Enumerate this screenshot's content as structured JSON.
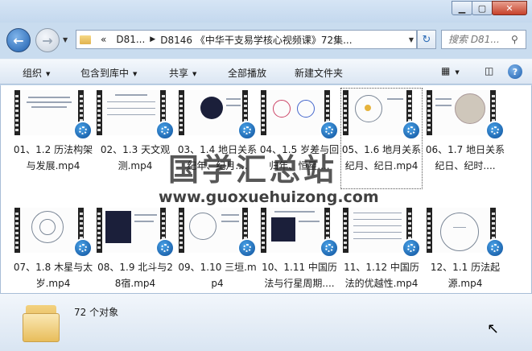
{
  "window": {
    "minimize": "▁",
    "maximize": "▢",
    "close": "✕"
  },
  "nav": {
    "back_icon": "arrow-left",
    "forward_icon": "arrow-right",
    "history_icon": "chevron-down",
    "address": {
      "overflow": "«",
      "crumbs": [
        "D81...",
        "D8146 《中华干支易学核心视频课》72集..."
      ]
    },
    "search_placeholder": "搜索 D81..."
  },
  "toolbar": {
    "organize": "组织",
    "include_library": "包含到库中",
    "share": "共享",
    "play_all": "全部播放",
    "new_folder": "新建文件夹",
    "help": "?"
  },
  "files": [
    {
      "name": "01、1.2 历法构架与发展.mp4"
    },
    {
      "name": "02、1.3 天文观测.mp4"
    },
    {
      "name": "03、1.4 地日关系纪年、纪月...."
    },
    {
      "name": "04、1.5 岁差与回归年、恒星...."
    },
    {
      "name": "05、1.6 地月关系纪月、纪日.mp4"
    },
    {
      "name": "06、1.7 地日关系纪日、纪时...."
    },
    {
      "name": "07、1.8 木星与太岁.mp4"
    },
    {
      "name": "08、1.9 北斗与28宿.mp4"
    },
    {
      "name": "09、1.10 三垣.mp4"
    },
    {
      "name": "10、1.11 中国历法与行星周期...."
    },
    {
      "name": "11、1.12 中国历法的优越性.mp4"
    },
    {
      "name": "12、1.1 历法起源.mp4"
    }
  ],
  "watermark": {
    "cn": "国学汇总站",
    "url": "www.guoxuehuizong.com"
  },
  "details": {
    "count": "72 个对象"
  }
}
